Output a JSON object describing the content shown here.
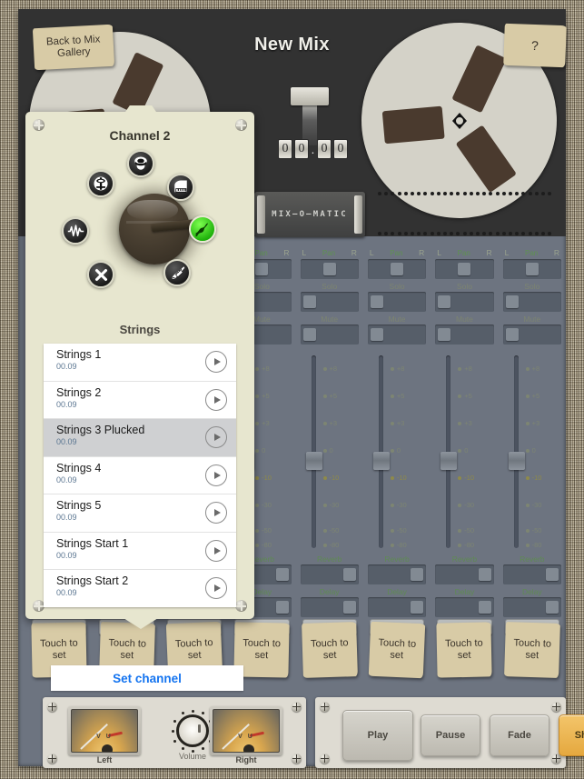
{
  "app": {
    "title": "New Mix",
    "brand": "MIX—O—MATIC",
    "back_label": "Back to Mix Gallery",
    "help_label": "?",
    "counter": [
      "0",
      "0",
      ".",
      "0",
      "0"
    ]
  },
  "mixer": {
    "channel_count": 8,
    "pan_left_label": "L",
    "pan_right_label": "R",
    "pan_value_label": "Pan",
    "solo_label": "Solo",
    "mute_label": "Mute",
    "reverb_label": "Reverb",
    "delay_label": "Delay",
    "fader_ticks": [
      "+8",
      "+5",
      "+3",
      "0",
      "-10",
      "-30",
      "-50",
      "-80"
    ],
    "fader_highlight_tick": "-10",
    "touch_to_set_label": "Touch to set",
    "play_icon": "play-triangle-icon"
  },
  "master": {
    "vu_left_label": "Left",
    "vu_right_label": "Right",
    "vu_face_label": "V U",
    "volume_label": "Volume",
    "transport": [
      {
        "label": "Play",
        "style": "grey",
        "name": "play-button"
      },
      {
        "label": "Pause",
        "style": "grey",
        "name": "pause-button"
      },
      {
        "label": "Fade",
        "style": "grey",
        "name": "fade-button"
      },
      {
        "label": "Share",
        "style": "amber",
        "name": "share-button"
      }
    ]
  },
  "modal": {
    "title": "Channel 2",
    "instrument": "Strings",
    "set_channel_label": "Set channel",
    "instrument_icons": [
      {
        "name": "drums-icon",
        "selected": false
      },
      {
        "name": "microphone-icon",
        "selected": false
      },
      {
        "name": "piano-icon",
        "selected": false
      },
      {
        "name": "waveform-icon",
        "selected": false
      },
      {
        "name": "strings-icon",
        "selected": true
      },
      {
        "name": "close-icon",
        "selected": false
      },
      {
        "name": "guitar-icon",
        "selected": false
      }
    ],
    "samples": [
      {
        "name": "Strings 1",
        "duration": "00.09",
        "selected": false
      },
      {
        "name": "Strings 2",
        "duration": "00.09",
        "selected": false
      },
      {
        "name": "Strings 3 Plucked",
        "duration": "00.09",
        "selected": true
      },
      {
        "name": "Strings 4",
        "duration": "00.09",
        "selected": false
      },
      {
        "name": "Strings 5",
        "duration": "00.09",
        "selected": false
      },
      {
        "name": "Strings Start 1",
        "duration": "00.09",
        "selected": false
      },
      {
        "name": "Strings Start 2",
        "duration": "00.09",
        "selected": false
      }
    ]
  },
  "colors": {
    "deck": "#6d7480",
    "deck_top": "#323232",
    "paper": "#d8cba6",
    "panel": "#e7e6cf",
    "accent_link": "#1474f0",
    "accent_share": "#e5a83f",
    "selected_icon": "#14a804"
  }
}
